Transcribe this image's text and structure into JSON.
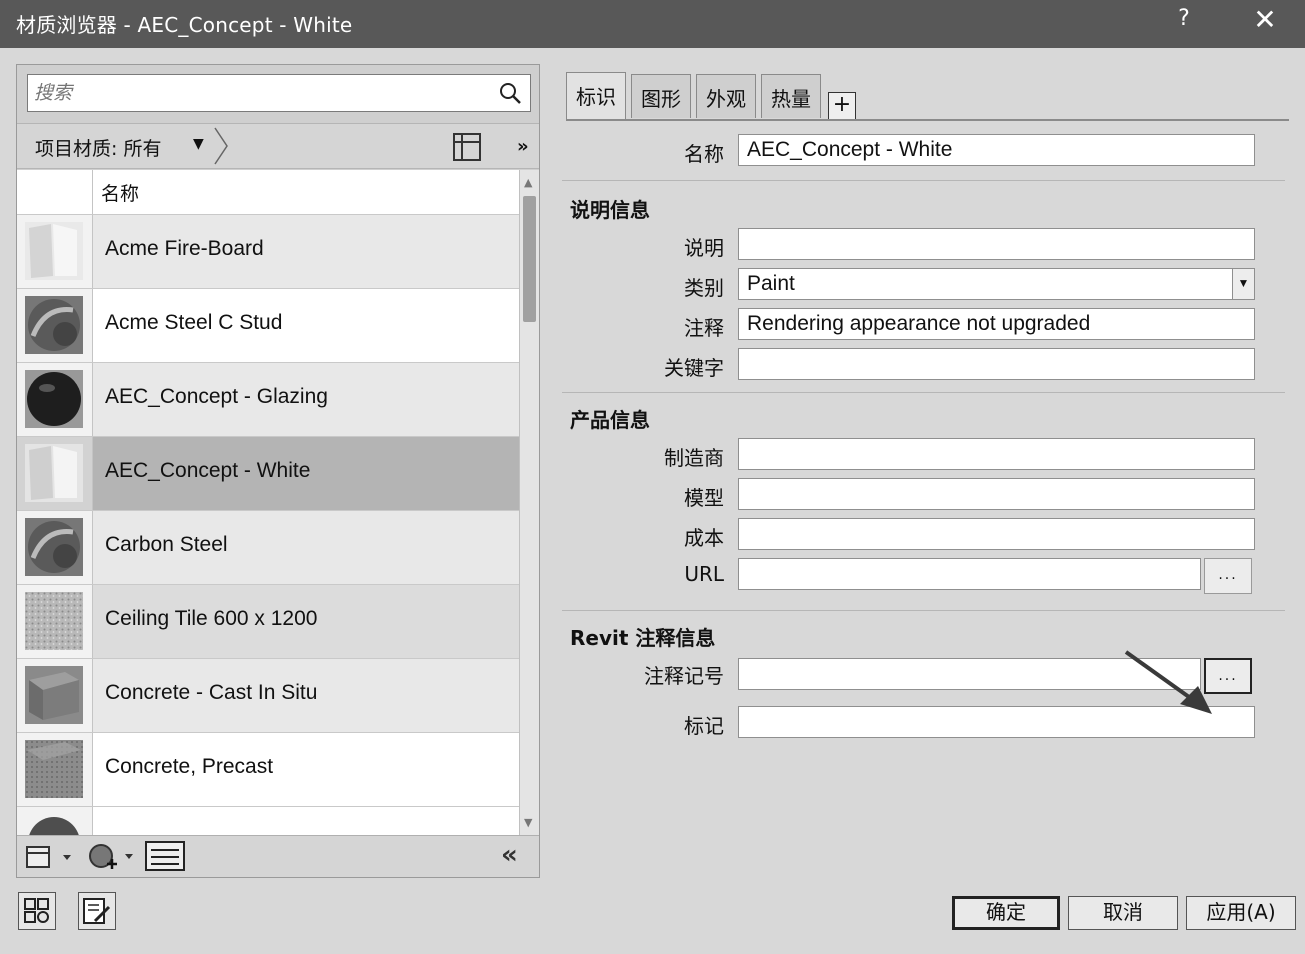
{
  "window": {
    "title": "材质浏览器 - AEC_Concept - White",
    "help_label": "?",
    "close_label": "✕"
  },
  "search": {
    "placeholder": "搜索"
  },
  "filter": {
    "label": "项目材质: 所有",
    "dropdown_glyph": "▼",
    "more_glyph": "»"
  },
  "list": {
    "column_name": "名称",
    "items": [
      {
        "label": "Acme Fire-Board",
        "icon": "fireboard-swatch-icon"
      },
      {
        "label": "Acme Steel C Stud",
        "icon": "steel-sphere-icon"
      },
      {
        "label": "AEC_Concept - Glazing",
        "icon": "glazing-sphere-icon"
      },
      {
        "label": "AEC_Concept - White",
        "icon": "white-board-swatch-icon",
        "selected": true
      },
      {
        "label": "Carbon Steel",
        "icon": "steel-sphere-icon"
      },
      {
        "label": "Ceiling Tile 600 x 1200",
        "icon": "ceiling-tile-swatch-icon"
      },
      {
        "label": "Concrete - Cast In Situ",
        "icon": "concrete-cube-icon"
      },
      {
        "label": "Concrete, Precast",
        "icon": "precast-cube-icon"
      }
    ]
  },
  "left_tools": {
    "collapse_glyph": "«"
  },
  "tabs": [
    {
      "label": "标识",
      "active": true
    },
    {
      "label": "图形"
    },
    {
      "label": "外观"
    },
    {
      "label": "热量"
    }
  ],
  "tab_add_label": "+",
  "identity": {
    "name_label": "名称",
    "name_value": "AEC_Concept - White"
  },
  "description_section": {
    "title": "说明信息",
    "description_label": "说明",
    "description_value": "",
    "category_label": "类别",
    "category_value": "Paint",
    "comments_label": "注释",
    "comments_value": "Rendering appearance not upgraded",
    "keywords_label": "关键字",
    "keywords_value": ""
  },
  "product_section": {
    "title": "产品信息",
    "manufacturer_label": "制造商",
    "manufacturer_value": "",
    "model_label": "模型",
    "model_value": "",
    "cost_label": "成本",
    "cost_value": "",
    "url_label": "URL",
    "url_value": "",
    "ellipsis": "..."
  },
  "revit_section": {
    "title": "Revit 注释信息",
    "keynote_label": "注释记号",
    "keynote_value": "",
    "mark_label": "标记",
    "mark_value": "",
    "ellipsis": "..."
  },
  "buttons": {
    "ok": "确定",
    "cancel": "取消",
    "apply": "应用(A)"
  }
}
